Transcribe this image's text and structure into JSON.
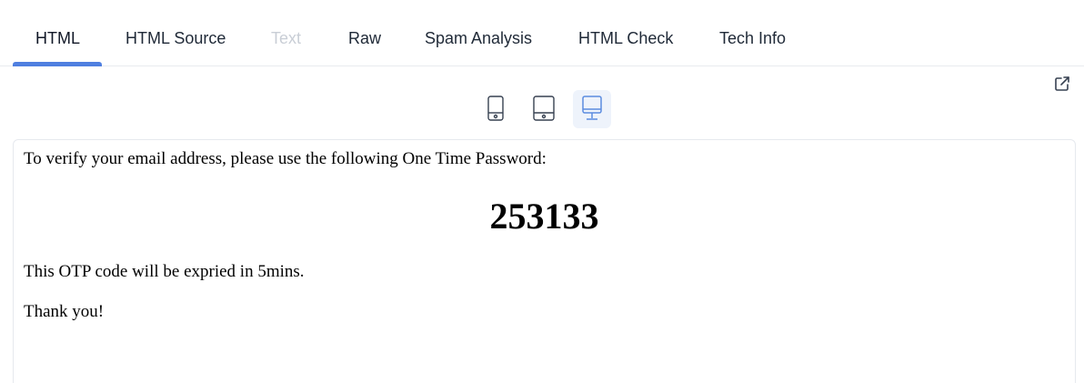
{
  "tabs": [
    {
      "label": "HTML",
      "state": "active"
    },
    {
      "label": "HTML Source",
      "state": "normal"
    },
    {
      "label": "Text",
      "state": "disabled"
    },
    {
      "label": "Raw",
      "state": "normal"
    },
    {
      "label": "Spam Analysis",
      "state": "normal"
    },
    {
      "label": "HTML Check",
      "state": "normal"
    },
    {
      "label": "Tech Info",
      "state": "normal"
    }
  ],
  "toolbar": {
    "open_external_icon": "external-link-icon",
    "devices": [
      {
        "icon": "mobile-phone-icon",
        "selected": false
      },
      {
        "icon": "tablet-icon",
        "selected": false
      },
      {
        "icon": "desktop-monitor-icon",
        "selected": true
      }
    ]
  },
  "email": {
    "intro": "To verify your email address, please use the following One Time Password:",
    "otp": "253133",
    "expiry": "This OTP code will be expried in 5mins.",
    "signoff": "Thank you!"
  },
  "colors": {
    "accent": "#4f7fe0",
    "tab_text": "#1f2937",
    "tab_disabled": "#c9ced6",
    "device_icon": "#374151",
    "device_selected_bg": "#eef3fb"
  }
}
